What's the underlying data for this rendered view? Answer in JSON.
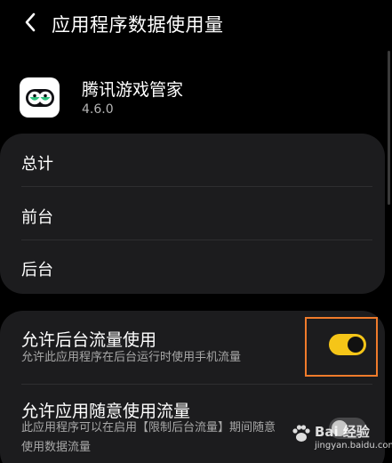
{
  "header": {
    "back_icon": "chevron-left-icon",
    "title": "应用程序数据使用量"
  },
  "app": {
    "icon": "tencent-game-manager-icon",
    "name": "腾讯游戏管家",
    "version": "4.6.0"
  },
  "usage_rows": [
    {
      "label": "总计"
    },
    {
      "label": "前台"
    },
    {
      "label": "后台"
    }
  ],
  "settings": [
    {
      "title": "允许后台流量使用",
      "description": "允许此应用程序在后台运行时使用手机流量",
      "enabled": true
    },
    {
      "title": "允许应用随意使用流量",
      "description_lines": [
        "此应用程序可以在启用【限制后台流量】期间随意",
        "使用数据流量"
      ],
      "enabled": false
    }
  ],
  "watermark": {
    "brand": "Bai 经验",
    "site": "jingyan.baidu.com"
  },
  "colors": {
    "background": "#000000",
    "card": "#1c1c1e",
    "toggle_on": "#f5c518",
    "highlight": "#f07b2b"
  }
}
